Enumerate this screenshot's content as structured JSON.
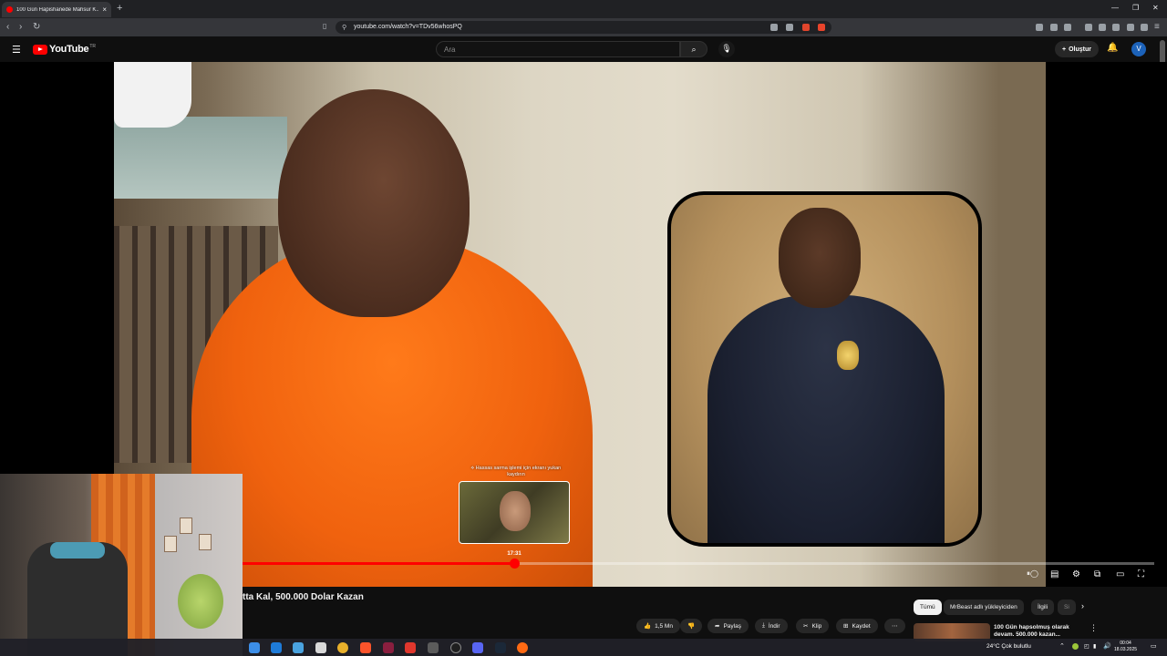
{
  "browser": {
    "tab_title": "100 Gün Hapishanede Mahsur K...",
    "url": "youtube.com/watch?v=TDv56whosPQ"
  },
  "header": {
    "logo_text": "YouTube",
    "logo_suffix": "TR",
    "search_placeholder": "Ara",
    "create_label": "Oluştur",
    "avatar_letter": "V"
  },
  "player": {
    "preview_text": "⟡ Hassas sarma işlemi için ekranı yukarı kaydırın",
    "preview_time": "17:31",
    "progress_fraction": 0.298
  },
  "video": {
    "title": "tta Kal, 500.000 Dolar Kazan"
  },
  "actions": {
    "likes": "1,5 Mn",
    "share": "Paylaş",
    "download": "İndir",
    "clip": "Klip",
    "save": "Kaydet"
  },
  "chips": [
    "Tümü",
    "MrBeast adlı yükleyiciden",
    "İlgili",
    "Si"
  ],
  "suggestion": {
    "title": "100 Gün hapsolmuş olarak devam. 500.000 kazan..."
  },
  "taskbar": {
    "weather": "24°C  Çok bulutlu",
    "time": "00:04",
    "date": "18.03.2025"
  },
  "colors": {
    "accent": "#ff0000",
    "background": "#0f0f0f",
    "chip": "#272727"
  }
}
